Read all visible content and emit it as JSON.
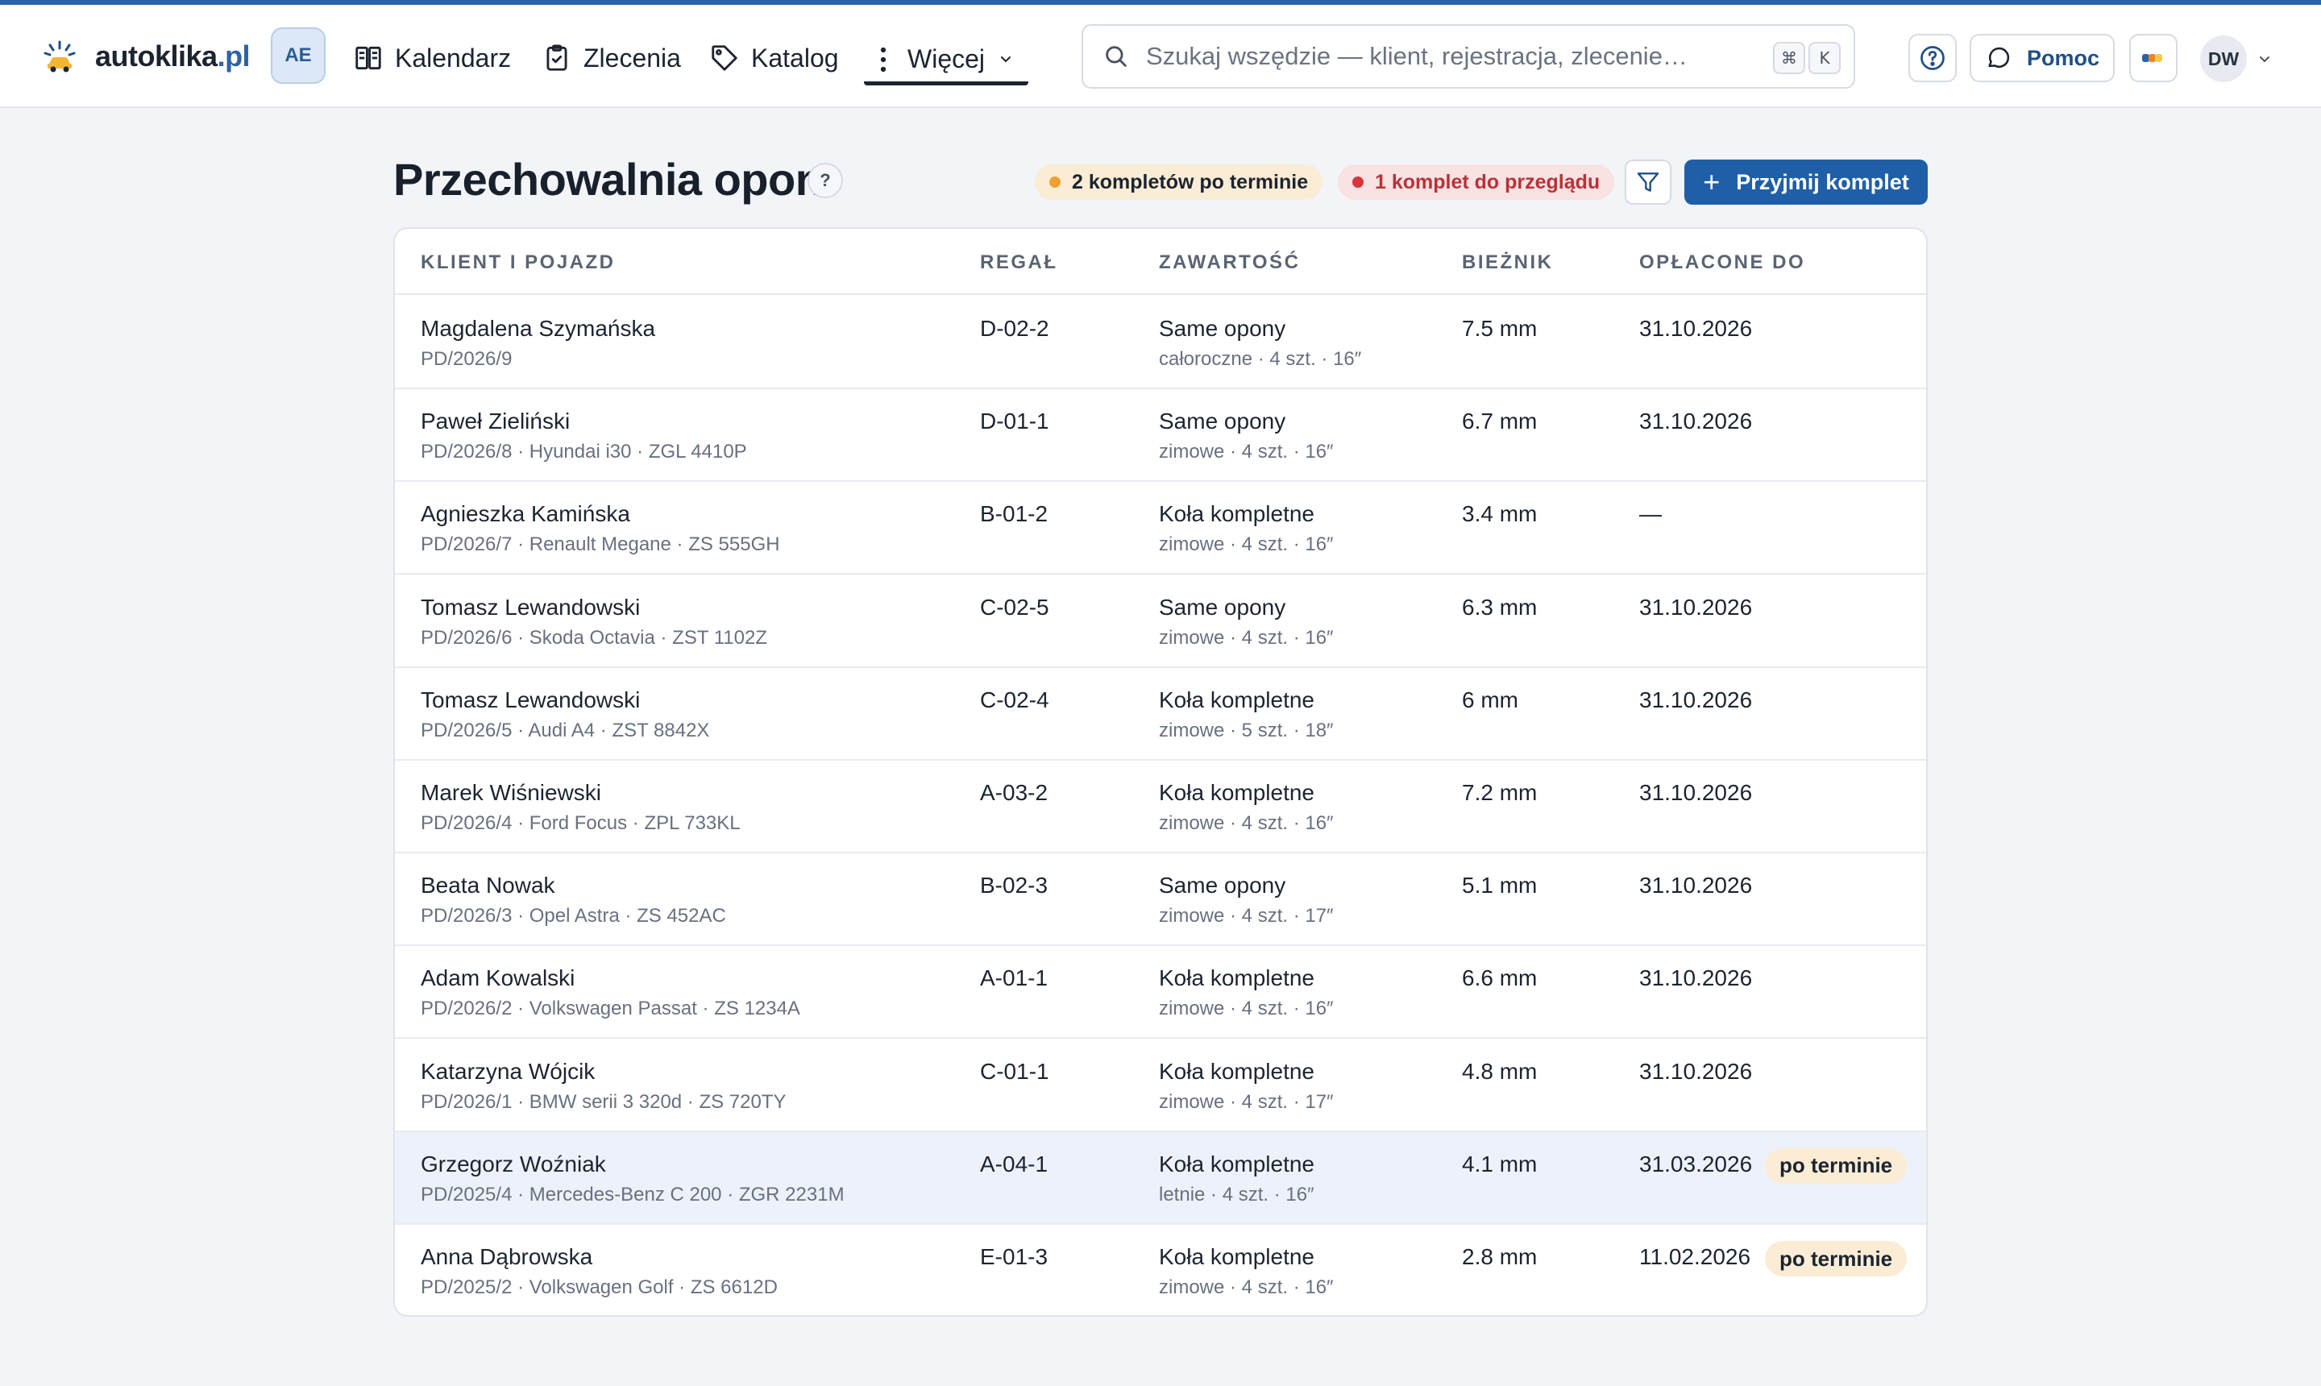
{
  "brand": {
    "name": "autoklika",
    "tld": ".pl"
  },
  "workspace_badge": "AE",
  "nav": {
    "items": [
      {
        "label": "Kalendarz"
      },
      {
        "label": "Zlecenia"
      },
      {
        "label": "Katalog"
      }
    ],
    "more_label": "Więcej"
  },
  "search": {
    "placeholder": "Szukaj wszędzie — klient, rejestracja, zlecenie…",
    "shortcut_keys": [
      "⌘",
      "K"
    ]
  },
  "header_actions": {
    "help_label": "Pomoc",
    "avatar_initials": "DW"
  },
  "page": {
    "title": "Przechowalnia opon",
    "title_help": "?",
    "alerts": [
      {
        "label": "2 kompletów po terminie",
        "color": "#f0a030"
      },
      {
        "label": "1 komplet do przeglądu",
        "color": "#d9353d"
      }
    ],
    "primary_action": "Przyjmij komplet"
  },
  "table": {
    "columns": [
      "KLIENT I POJAZD",
      "REGAŁ",
      "ZAWARTOŚĆ",
      "BIEŻNIK",
      "OPŁACONE DO"
    ],
    "rows": [
      {
        "client": "Magdalena Szymańska",
        "ref": "PD/2026/9",
        "rack": "D-02-2",
        "content": "Same opony",
        "details": "całoroczne · 4 szt. · 16″",
        "tread": "7.5 mm",
        "paid_until": "31.10.2026",
        "badge": ""
      },
      {
        "client": "Paweł Zieliński",
        "ref": "PD/2026/8 · Hyundai i30 · ZGL 4410P",
        "rack": "D-01-1",
        "content": "Same opony",
        "details": "zimowe · 4 szt. · 16″",
        "tread": "6.7 mm",
        "paid_until": "31.10.2026",
        "badge": ""
      },
      {
        "client": "Agnieszka Kamińska",
        "ref": "PD/2026/7 · Renault Megane · ZS 555GH",
        "rack": "B-01-2",
        "content": "Koła kompletne",
        "details": "zimowe · 4 szt. · 16″",
        "tread": "3.4 mm",
        "paid_until": "—",
        "badge": ""
      },
      {
        "client": "Tomasz Lewandowski",
        "ref": "PD/2026/6 · Skoda Octavia · ZST 1102Z",
        "rack": "C-02-5",
        "content": "Same opony",
        "details": "zimowe · 4 szt. · 16″",
        "tread": "6.3 mm",
        "paid_until": "31.10.2026",
        "badge": ""
      },
      {
        "client": "Tomasz Lewandowski",
        "ref": "PD/2026/5 · Audi A4 · ZST 8842X",
        "rack": "C-02-4",
        "content": "Koła kompletne",
        "details": "zimowe · 5 szt. · 18″",
        "tread": "6 mm",
        "paid_until": "31.10.2026",
        "badge": ""
      },
      {
        "client": "Marek Wiśniewski",
        "ref": "PD/2026/4 · Ford Focus · ZPL 733KL",
        "rack": "A-03-2",
        "content": "Koła kompletne",
        "details": "zimowe · 4 szt. · 16″",
        "tread": "7.2 mm",
        "paid_until": "31.10.2026",
        "badge": ""
      },
      {
        "client": "Beata Nowak",
        "ref": "PD/2026/3 · Opel Astra · ZS 452AC",
        "rack": "B-02-3",
        "content": "Same opony",
        "details": "zimowe · 4 szt. · 17″",
        "tread": "5.1 mm",
        "paid_until": "31.10.2026",
        "badge": ""
      },
      {
        "client": "Adam Kowalski",
        "ref": "PD/2026/2 · Volkswagen Passat · ZS 1234A",
        "rack": "A-01-1",
        "content": "Koła kompletne",
        "details": "zimowe · 4 szt. · 16″",
        "tread": "6.6 mm",
        "paid_until": "31.10.2026",
        "badge": ""
      },
      {
        "client": "Katarzyna Wójcik",
        "ref": "PD/2026/1 · BMW serii 3 320d · ZS 720TY",
        "rack": "C-01-1",
        "content": "Koła kompletne",
        "details": "zimowe · 4 szt. · 17″",
        "tread": "4.8 mm",
        "paid_until": "31.10.2026",
        "badge": ""
      },
      {
        "client": "Grzegorz Woźniak",
        "ref": "PD/2025/4 · Mercedes-Benz C 200 · ZGR 2231M",
        "rack": "A-04-1",
        "content": "Koła kompletne",
        "details": "letnie · 4 szt. · 16″",
        "tread": "4.1 mm",
        "paid_until": "31.03.2026",
        "badge": "po terminie"
      },
      {
        "client": "Anna Dąbrowska",
        "ref": "PD/2025/2 · Volkswagen Golf · ZS 6612D",
        "rack": "E-01-3",
        "content": "Koła kompletne",
        "details": "zimowe · 4 szt. · 16″",
        "tread": "2.8 mm",
        "paid_until": "11.02.2026",
        "badge": "po terminie"
      }
    ]
  },
  "colors": {
    "accent": "#1f5fa8",
    "warning": "#f0a030",
    "danger": "#d9353d",
    "highlight_row": "#edf2fa"
  },
  "icons": {
    "logo": "car-sparkle-icon",
    "kalendarz": "book-open-icon",
    "zlecenia": "clipboard-check-icon",
    "katalog": "tag-icon",
    "wiecej": "more-vertical-icon",
    "search": "search-icon",
    "help": "help-circle-icon",
    "pomoc": "message-circle-icon",
    "filter": "filter-icon"
  }
}
